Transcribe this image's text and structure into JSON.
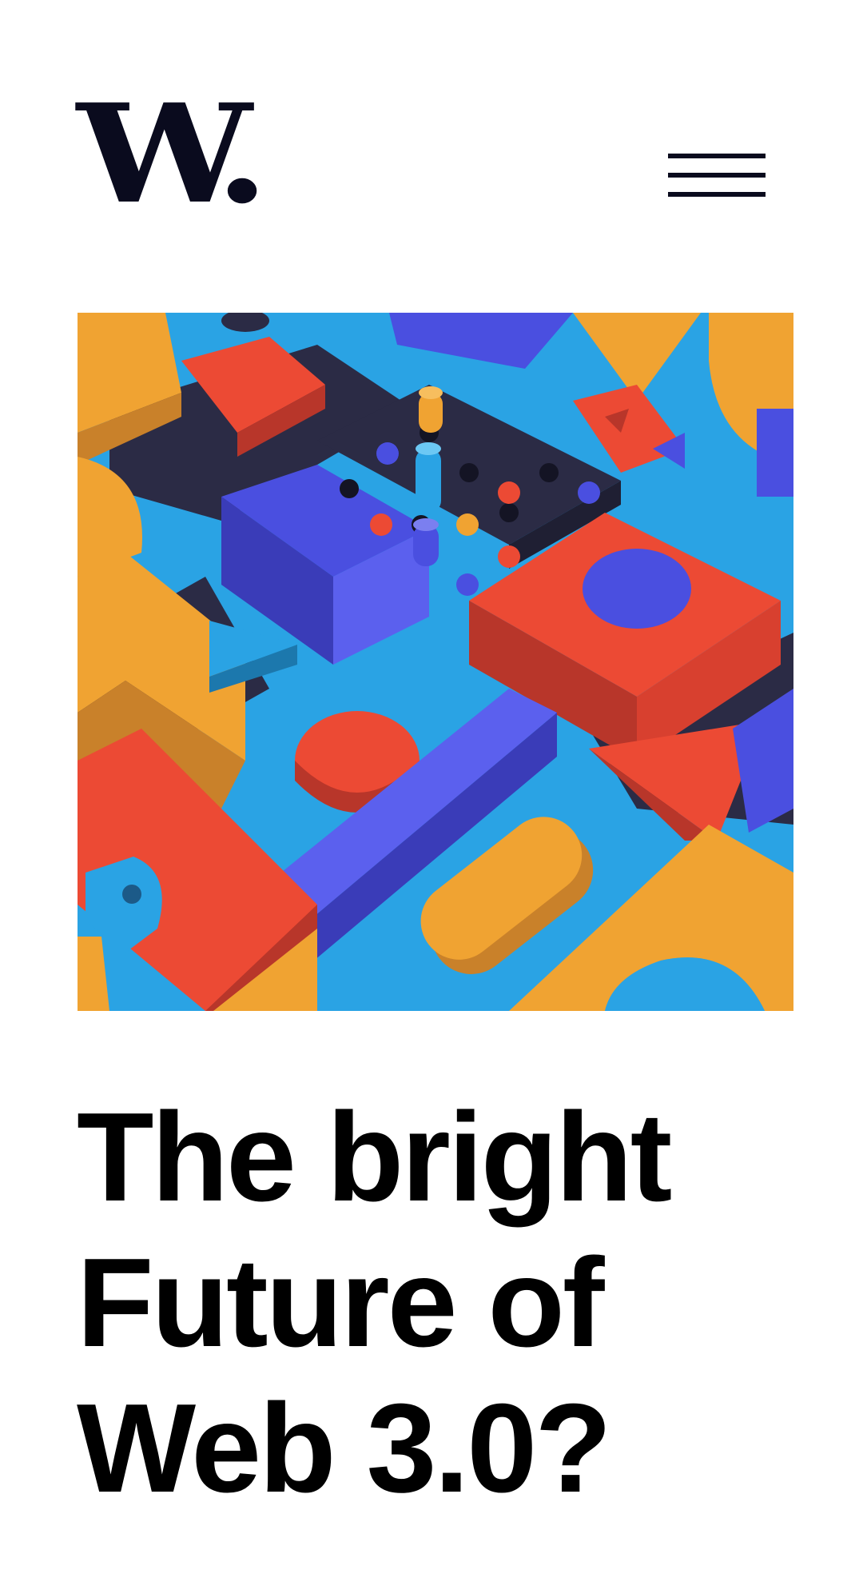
{
  "header": {
    "logo_text": "W.",
    "menu_icon": "hamburger-icon"
  },
  "hero": {
    "image": "colorful-3d-geometric-blocks-illustration"
  },
  "article": {
    "title_lines": [
      "The bright",
      "Future of",
      "Web 3.0?"
    ]
  },
  "colors": {
    "ink": "#0a0b1e",
    "orange": "#f0a332",
    "red": "#ec4a34",
    "blue": "#4a4fe0",
    "sky": "#2aa3e4",
    "navy": "#2b2b45"
  }
}
